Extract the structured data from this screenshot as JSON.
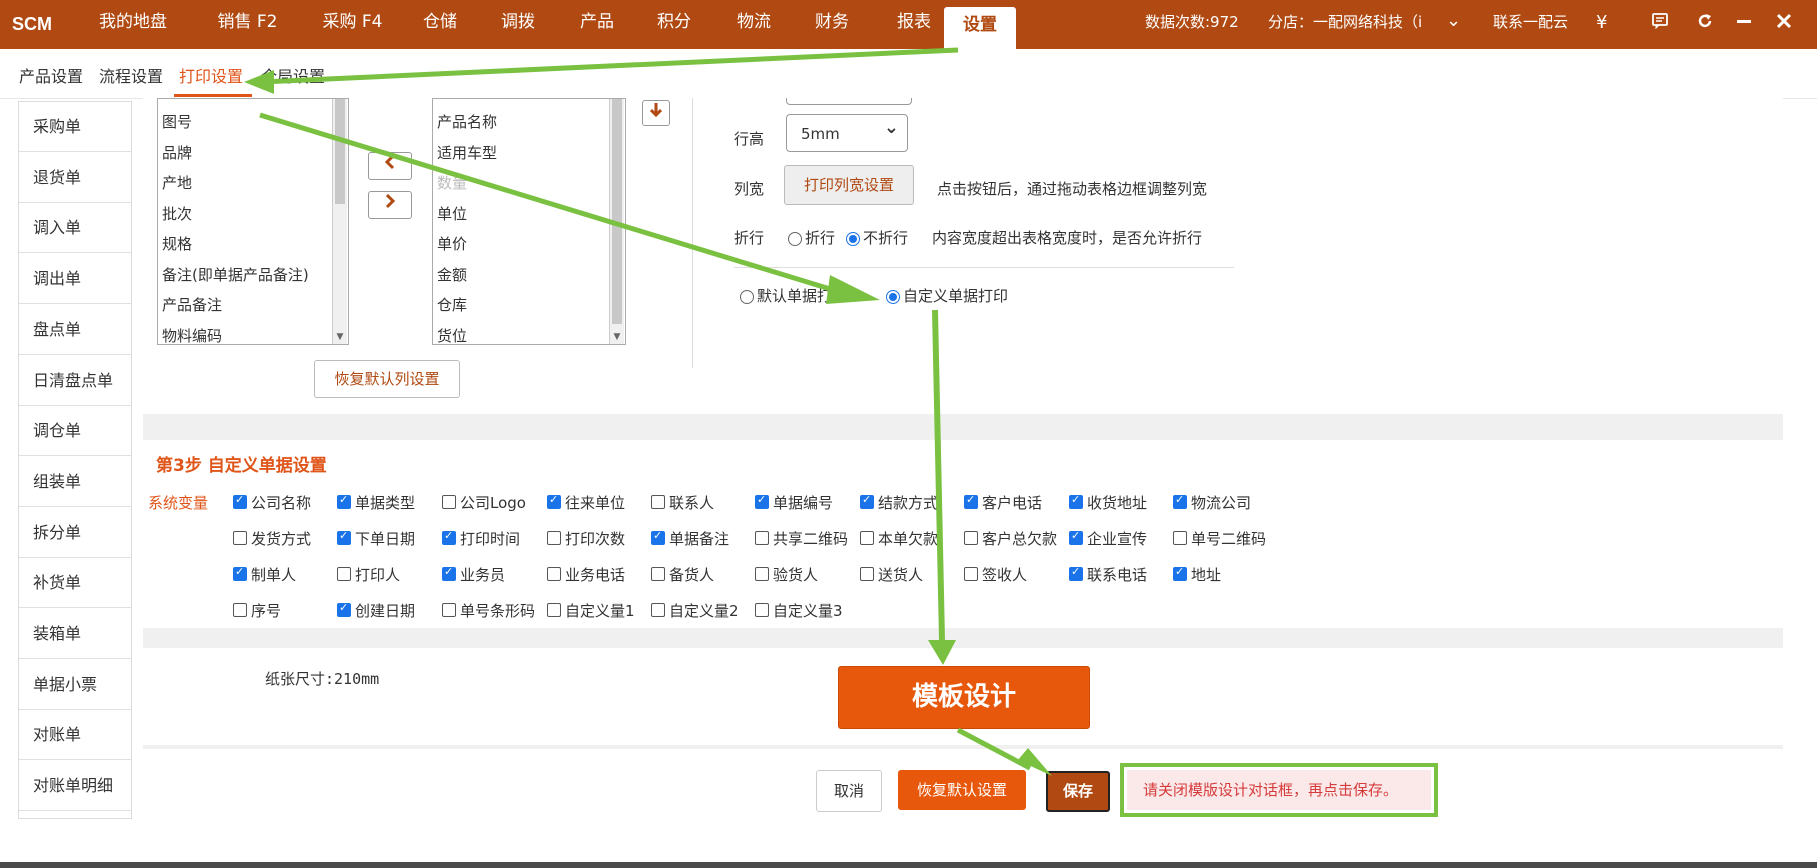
{
  "app": {
    "logo": "SCM"
  },
  "topnav": {
    "items": [
      "我的地盘",
      "销售 F2",
      "采购 F4",
      "仓储",
      "调拨",
      "产品",
      "积分",
      "物流",
      "财务",
      "报表",
      "设置"
    ],
    "active": "设置",
    "data_count": "数据次数:972",
    "branch": "分店：一配网络科技（i",
    "contact": "联系一配云",
    "currency_symbol": "¥",
    "icons": [
      "chevron-down-icon",
      "chat-icon",
      "refresh-icon",
      "minimize-icon",
      "close-icon"
    ]
  },
  "subnav": {
    "items": [
      "产品设置",
      "流程设置",
      "打印设置",
      "全局设置"
    ],
    "active": "打印设置"
  },
  "sidebar": {
    "items": [
      "采购单",
      "退货单",
      "调入单",
      "调出单",
      "盘点单",
      "日清盘点单",
      "调仓单",
      "组装单",
      "拆分单",
      "补货单",
      "装箱单",
      "单据小票",
      "对账单",
      "对账单明细"
    ]
  },
  "columns": {
    "available": [
      "图号",
      "品牌",
      "产地",
      "批次",
      "规格",
      "备注(即单据产品备注)",
      "产品备注",
      "物料编码"
    ],
    "selected": [
      {
        "label": "产品名称",
        "disabled": false
      },
      {
        "label": "适用车型",
        "disabled": false
      },
      {
        "label": "数量",
        "disabled": true
      },
      {
        "label": "单位",
        "disabled": false
      },
      {
        "label": "单价",
        "disabled": false
      },
      {
        "label": "金额",
        "disabled": false
      },
      {
        "label": "仓库",
        "disabled": false
      },
      {
        "label": "货位",
        "disabled": false
      }
    ],
    "move_left": "<",
    "move_right": ">",
    "move_down": "↓",
    "reset_button": "恢复默认列设置"
  },
  "settings": {
    "row_height_label": "行高",
    "row_height_value": "5mm",
    "col_width_label": "列宽",
    "col_width_button": "打印列宽设置",
    "col_width_hint": "点击按钮后，通过拖动表格边框调整列宽",
    "wrap_label": "折行",
    "wrap_options": [
      "折行",
      "不折行"
    ],
    "wrap_selected": "不折行",
    "wrap_hint": "内容宽度超出表格宽度时，是否允许折行",
    "print_mode_options": [
      "默认单据打印",
      "自定义单据打印"
    ],
    "print_mode_selected": "自定义单据打印"
  },
  "step3": {
    "title": "第3步 自定义单据设置",
    "vars_label": "系统变量",
    "rows": [
      [
        {
          "label": "公司名称",
          "checked": true
        },
        {
          "label": "单据类型",
          "checked": true
        },
        {
          "label": "公司Logo",
          "checked": false
        },
        {
          "label": "往来单位",
          "checked": true
        },
        {
          "label": "联系人",
          "checked": false
        },
        {
          "label": "单据编号",
          "checked": true
        },
        {
          "label": "结款方式",
          "checked": true
        },
        {
          "label": "客户电话",
          "checked": true
        },
        {
          "label": "收货地址",
          "checked": true
        },
        {
          "label": "物流公司",
          "checked": true
        }
      ],
      [
        {
          "label": "发货方式",
          "checked": false
        },
        {
          "label": "下单日期",
          "checked": true
        },
        {
          "label": "打印时间",
          "checked": true
        },
        {
          "label": "打印次数",
          "checked": false
        },
        {
          "label": "单据备注",
          "checked": true
        },
        {
          "label": "共享二维码",
          "checked": false
        },
        {
          "label": "本单欠款",
          "checked": false
        },
        {
          "label": "客户总欠款",
          "checked": false
        },
        {
          "label": "企业宣传",
          "checked": true
        },
        {
          "label": "单号二维码",
          "checked": false
        }
      ],
      [
        {
          "label": "制单人",
          "checked": true
        },
        {
          "label": "打印人",
          "checked": false
        },
        {
          "label": "业务员",
          "checked": true
        },
        {
          "label": "业务电话",
          "checked": false
        },
        {
          "label": "备货人",
          "checked": false
        },
        {
          "label": "验货人",
          "checked": false
        },
        {
          "label": "送货人",
          "checked": false
        },
        {
          "label": "签收人",
          "checked": false
        },
        {
          "label": "联系电话",
          "checked": true
        },
        {
          "label": "地址",
          "checked": true
        }
      ],
      [
        {
          "label": "序号",
          "checked": false
        },
        {
          "label": "创建日期",
          "checked": true
        },
        {
          "label": "单号条形码",
          "checked": false
        },
        {
          "label": "自定义量1",
          "checked": false
        },
        {
          "label": "自定义量2",
          "checked": false
        },
        {
          "label": "自定义量3",
          "checked": false
        }
      ]
    ]
  },
  "template": {
    "paper_size": "纸张尺寸:210mm",
    "design_button": "模板设计"
  },
  "footer": {
    "cancel": "取消",
    "restore_default": "恢复默认设置",
    "save": "保存",
    "tip": "请关闭模版设计对话框，再点击保存。"
  },
  "colors": {
    "brand": "#b04a12",
    "accent": "#e8580c",
    "annotation": "#7ac142",
    "tip_text": "#d63b3b"
  }
}
